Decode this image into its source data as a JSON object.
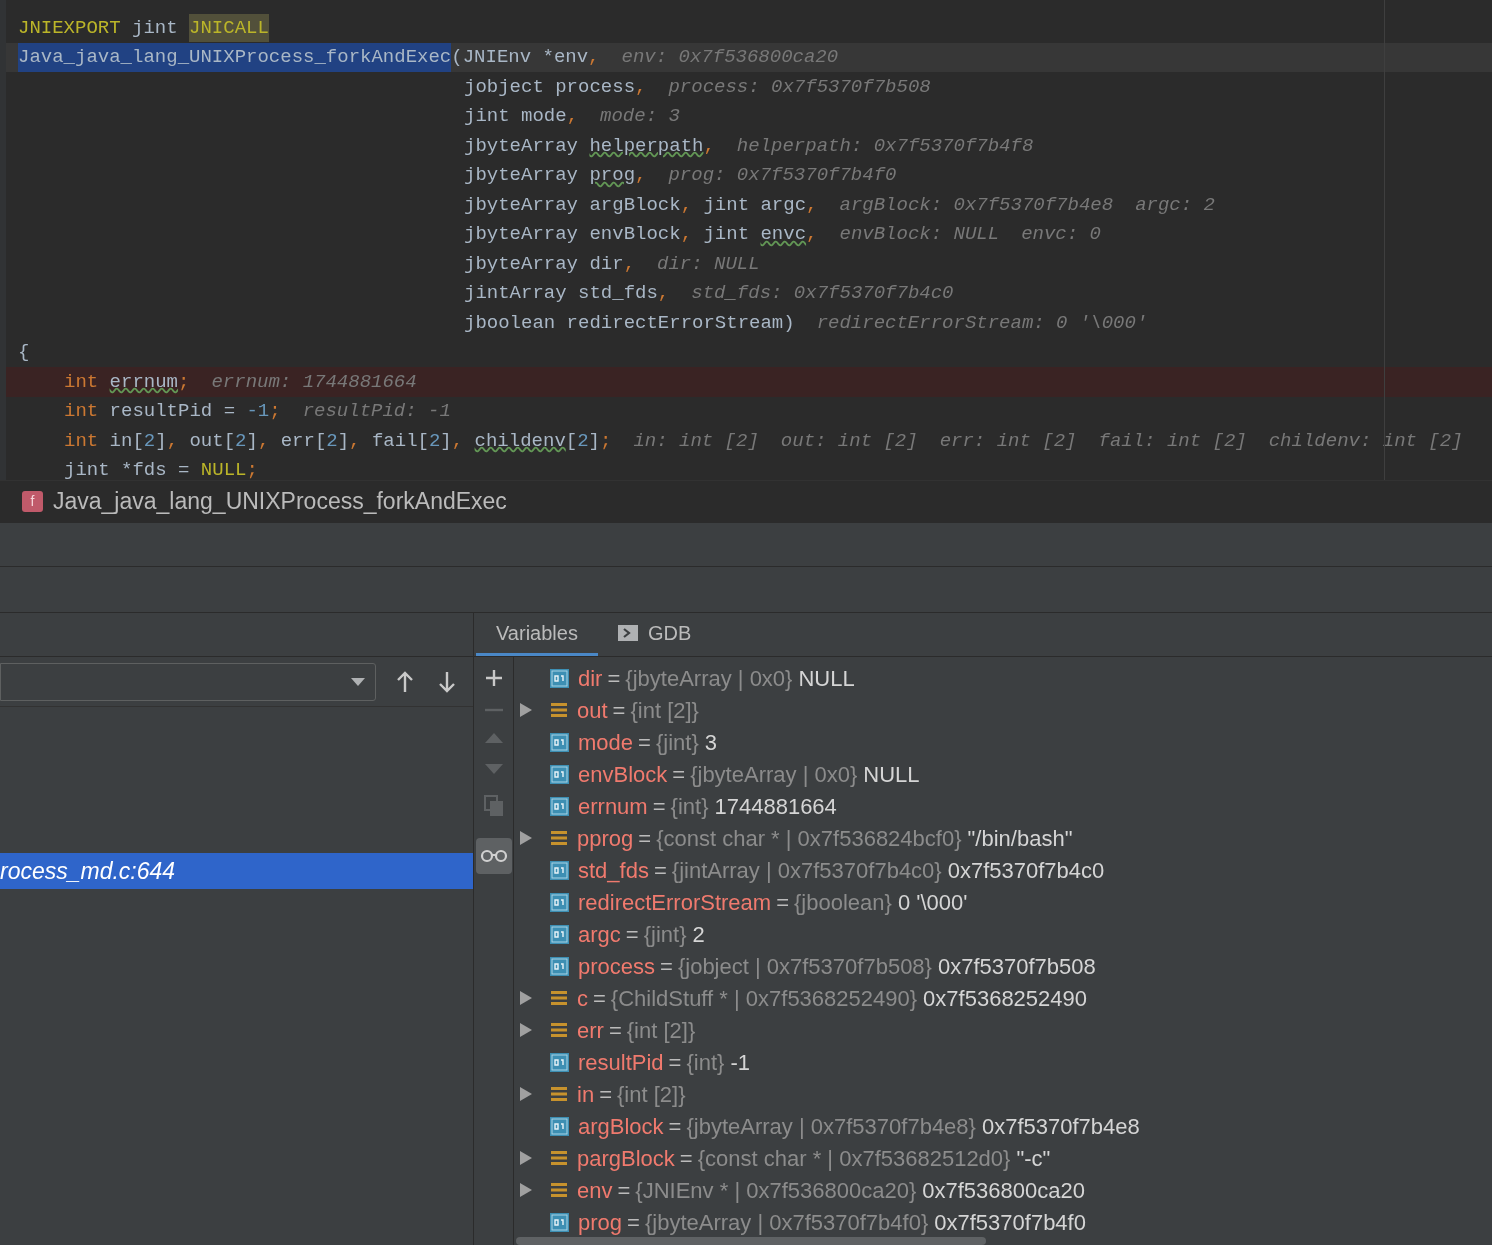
{
  "editor": {
    "lines": [
      {
        "kind": "top",
        "current": false,
        "breakpoint": false,
        "tokens": [
          {
            "text": "JNIEXPORT",
            "kind": "macro"
          },
          {
            "text": " jint ",
            "kind": "plain"
          },
          {
            "text": "JNICALL",
            "kind": "macro_hl"
          }
        ]
      },
      {
        "kind": "top",
        "current": true,
        "breakpoint": false,
        "tokens": [
          {
            "text": "Java_java_lang_UNIXProcess_forkAndExec",
            "kind": "selected"
          },
          {
            "text": "(JNIEnv *env",
            "kind": "plain"
          },
          {
            "text": ",",
            "kind": "punct"
          },
          {
            "text": "env: 0x7f536800ca20",
            "kind": "hint"
          }
        ]
      },
      {
        "kind": "param",
        "current": false,
        "breakpoint": false,
        "tokens": [
          {
            "text": "jobject process",
            "kind": "plain"
          },
          {
            "text": ",",
            "kind": "punct"
          },
          {
            "text": "process: 0x7f5370f7b508",
            "kind": "hint"
          }
        ]
      },
      {
        "kind": "param",
        "current": false,
        "breakpoint": false,
        "tokens": [
          {
            "text": "jint mode",
            "kind": "plain"
          },
          {
            "text": ",",
            "kind": "punct"
          },
          {
            "text": "mode: 3",
            "kind": "hint"
          }
        ]
      },
      {
        "kind": "param",
        "current": false,
        "breakpoint": false,
        "tokens": [
          {
            "text": "jbyteArray ",
            "kind": "plain"
          },
          {
            "text": "helperpath",
            "kind": "typo"
          },
          {
            "text": ",",
            "kind": "punct"
          },
          {
            "text": "helperpath: 0x7f5370f7b4f8",
            "kind": "hint"
          }
        ]
      },
      {
        "kind": "param",
        "current": false,
        "breakpoint": false,
        "tokens": [
          {
            "text": "jbyteArray ",
            "kind": "plain"
          },
          {
            "text": "prog",
            "kind": "typo"
          },
          {
            "text": ",",
            "kind": "punct"
          },
          {
            "text": "prog: 0x7f5370f7b4f0",
            "kind": "hint"
          }
        ]
      },
      {
        "kind": "param",
        "current": false,
        "breakpoint": false,
        "tokens": [
          {
            "text": "jbyteArray argBlock",
            "kind": "plain"
          },
          {
            "text": ", ",
            "kind": "punct"
          },
          {
            "text": "jint argc",
            "kind": "plain"
          },
          {
            "text": ",",
            "kind": "punct"
          },
          {
            "text": "argBlock: 0x7f5370f7b4e8",
            "kind": "hint"
          },
          {
            "text": "argc: 2",
            "kind": "hint"
          }
        ]
      },
      {
        "kind": "param",
        "current": false,
        "breakpoint": false,
        "tokens": [
          {
            "text": "jbyteArray envBlock",
            "kind": "plain"
          },
          {
            "text": ", ",
            "kind": "punct"
          },
          {
            "text": "jint ",
            "kind": "plain"
          },
          {
            "text": "envc",
            "kind": "typo"
          },
          {
            "text": ",",
            "kind": "punct"
          },
          {
            "text": "envBlock: NULL",
            "kind": "hint"
          },
          {
            "text": "envc: 0",
            "kind": "hint"
          }
        ]
      },
      {
        "kind": "param",
        "current": false,
        "breakpoint": false,
        "tokens": [
          {
            "text": "jbyteArray dir",
            "kind": "plain"
          },
          {
            "text": ",",
            "kind": "punct"
          },
          {
            "text": "dir: NULL",
            "kind": "hint"
          }
        ]
      },
      {
        "kind": "param",
        "current": false,
        "breakpoint": false,
        "tokens": [
          {
            "text": "jintArray std_fds",
            "kind": "plain"
          },
          {
            "text": ",",
            "kind": "punct"
          },
          {
            "text": "std_fds: 0x7f5370f7b4c0",
            "kind": "hint"
          }
        ]
      },
      {
        "kind": "param",
        "current": false,
        "breakpoint": false,
        "tokens": [
          {
            "text": "jboolean redirectErrorStream)",
            "kind": "plain"
          },
          {
            "text": "redirectErrorStream: 0 '\\000'",
            "kind": "hint"
          }
        ]
      },
      {
        "kind": "top",
        "current": false,
        "breakpoint": false,
        "tokens": [
          {
            "text": "{",
            "kind": "plain"
          }
        ]
      },
      {
        "kind": "body",
        "current": false,
        "breakpoint": true,
        "tokens": [
          {
            "text": "int ",
            "kind": "keyword"
          },
          {
            "text": "errnum",
            "kind": "typo"
          },
          {
            "text": ";",
            "kind": "punct"
          },
          {
            "text": "errnum: 1744881664",
            "kind": "hint"
          }
        ]
      },
      {
        "kind": "body",
        "current": false,
        "breakpoint": false,
        "tokens": [
          {
            "text": "int ",
            "kind": "keyword"
          },
          {
            "text": "resultPid = ",
            "kind": "plain"
          },
          {
            "text": "-1",
            "kind": "number"
          },
          {
            "text": ";",
            "kind": "punct"
          },
          {
            "text": "resultPid: -1",
            "kind": "hint"
          }
        ]
      },
      {
        "kind": "body",
        "current": false,
        "breakpoint": false,
        "tokens": [
          {
            "text": "int ",
            "kind": "keyword"
          },
          {
            "text": "in[",
            "kind": "plain"
          },
          {
            "text": "2",
            "kind": "number"
          },
          {
            "text": "]",
            "kind": "plain"
          },
          {
            "text": ", ",
            "kind": "punct"
          },
          {
            "text": "out[",
            "kind": "plain"
          },
          {
            "text": "2",
            "kind": "number"
          },
          {
            "text": "]",
            "kind": "plain"
          },
          {
            "text": ", ",
            "kind": "punct"
          },
          {
            "text": "err[",
            "kind": "plain"
          },
          {
            "text": "2",
            "kind": "number"
          },
          {
            "text": "]",
            "kind": "plain"
          },
          {
            "text": ", ",
            "kind": "punct"
          },
          {
            "text": "fail[",
            "kind": "plain"
          },
          {
            "text": "2",
            "kind": "number"
          },
          {
            "text": "]",
            "kind": "plain"
          },
          {
            "text": ", ",
            "kind": "punct"
          },
          {
            "text": "childenv",
            "kind": "typo"
          },
          {
            "text": "[",
            "kind": "plain"
          },
          {
            "text": "2",
            "kind": "number"
          },
          {
            "text": "]",
            "kind": "plain"
          },
          {
            "text": ";",
            "kind": "punct"
          },
          {
            "text": "in: int [2]",
            "kind": "hint"
          },
          {
            "text": "out: int [2]",
            "kind": "hint"
          },
          {
            "text": "err: int [2]",
            "kind": "hint"
          },
          {
            "text": "fail: int [2]",
            "kind": "hint"
          },
          {
            "text": "childenv: int [2]",
            "kind": "hint"
          }
        ]
      },
      {
        "kind": "body",
        "current": false,
        "breakpoint": false,
        "tokens": [
          {
            "text": "jint ",
            "kind": "plain"
          },
          {
            "text": "*fds = ",
            "kind": "plain"
          },
          {
            "text": "NULL",
            "kind": "macro"
          },
          {
            "text": ";",
            "kind": "punct"
          }
        ]
      }
    ]
  },
  "breadcrumb": {
    "badge": "f",
    "label": "Java_java_lang_UNIXProcess_forkAndExec"
  },
  "frames": {
    "items": [
      {
        "label": "rocess_md.c:644",
        "selected": true
      }
    ]
  },
  "tabs": [
    {
      "label": "Variables",
      "selected": true
    },
    {
      "label": "GDB",
      "selected": false
    }
  ],
  "variables": [
    {
      "kind": "leaf",
      "op": "=",
      "name": "dir",
      "type": "{jbyteArray | 0x0}",
      "value": "NULL"
    },
    {
      "kind": "group",
      "op": "=",
      "name": "out",
      "type": "{int [2]}"
    },
    {
      "kind": "leaf",
      "op": "=",
      "name": "mode",
      "type": "{jint}",
      "value": "3"
    },
    {
      "kind": "leaf",
      "op": "=",
      "name": "envBlock",
      "type": "{jbyteArray | 0x0}",
      "value": "NULL"
    },
    {
      "kind": "leaf",
      "op": "=",
      "name": "errnum",
      "type": "{int}",
      "value": "1744881664"
    },
    {
      "kind": "group",
      "op": "=",
      "name": "pprog",
      "type": "{const char * | 0x7f536824bcf0}",
      "value": "\"/bin/bash\""
    },
    {
      "kind": "leaf",
      "op": "=",
      "name": "std_fds",
      "type": "{jintArray | 0x7f5370f7b4c0}",
      "value": "0x7f5370f7b4c0"
    },
    {
      "kind": "leaf",
      "op": "=",
      "name": "redirectErrorStream",
      "type": "{jboolean}",
      "value": "0 '\\000'"
    },
    {
      "kind": "leaf",
      "op": "=",
      "name": "argc",
      "type": "{jint}",
      "value": "2"
    },
    {
      "kind": "leaf",
      "op": "=",
      "name": "process",
      "type": "{jobject | 0x7f5370f7b508}",
      "value": "0x7f5370f7b508"
    },
    {
      "kind": "group",
      "op": "=",
      "name": "c",
      "type": "{ChildStuff * | 0x7f5368252490}",
      "value": "0x7f5368252490"
    },
    {
      "kind": "group",
      "op": "=",
      "name": "err",
      "type": "{int [2]}"
    },
    {
      "kind": "leaf",
      "op": "=",
      "name": "resultPid",
      "type": "{int}",
      "value": "-1"
    },
    {
      "kind": "group",
      "op": "=",
      "name": "in",
      "type": "{int [2]}"
    },
    {
      "kind": "leaf",
      "op": "=",
      "name": "argBlock",
      "type": "{jbyteArray | 0x7f5370f7b4e8}",
      "value": "0x7f5370f7b4e8"
    },
    {
      "kind": "group",
      "op": "=",
      "name": "pargBlock",
      "type": "{const char * | 0x7f53682512d0}",
      "value": "\"-c\""
    },
    {
      "kind": "group",
      "op": "=",
      "name": "env",
      "type": "{JNIEnv * | 0x7f536800ca20}",
      "value": "0x7f536800ca20"
    },
    {
      "kind": "leaf",
      "op": "=",
      "name": "prog",
      "type": "{jbyteArray | 0x7f5370f7b4f0}",
      "value": "0x7f5370f7b4f0"
    }
  ]
}
